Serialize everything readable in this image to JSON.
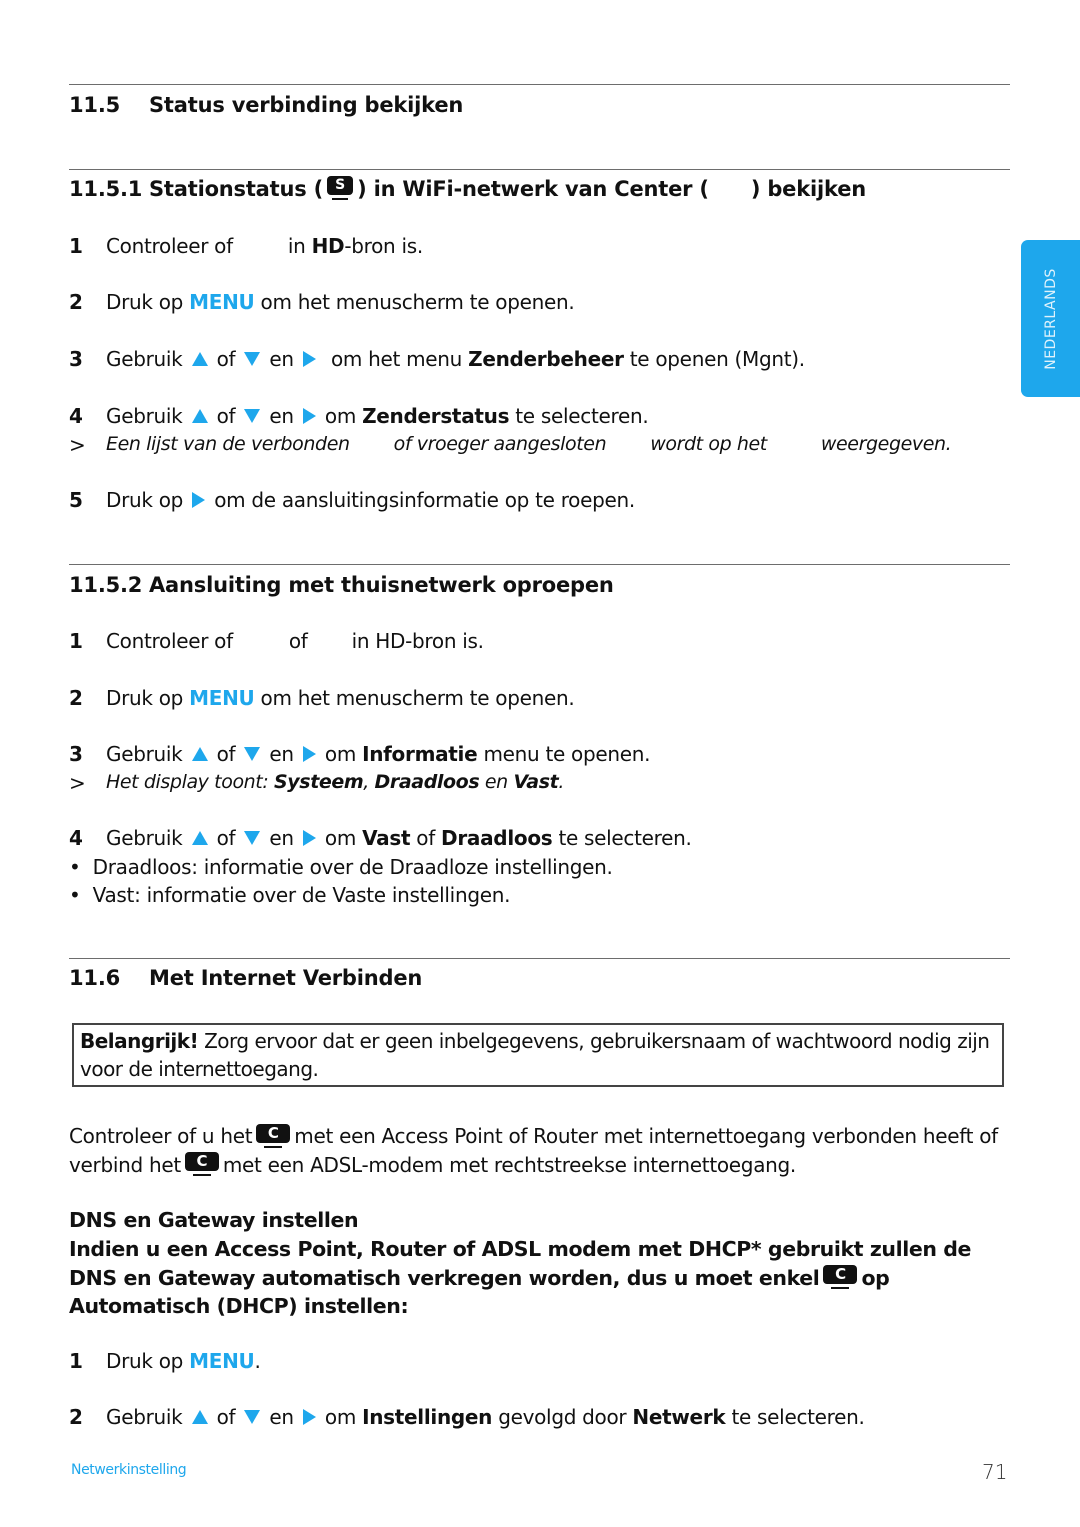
{
  "side_tab": {
    "label": "NEDERLANDS"
  },
  "section_11_5": {
    "number": "11.5",
    "title": "Status verbinding bekijken"
  },
  "section_11_5_1": {
    "number": "11.5.1",
    "title_a": "Stationstatus (",
    "icon_a": "S",
    "title_b": ") in WiFi-netwerk van Center (",
    "title_c": ") bekijken",
    "steps": [
      {
        "num": "1",
        "a": "Controleer of",
        "b": "in",
        "c": "HD",
        "d": "-bron is."
      },
      {
        "num": "2",
        "a": "Druk op",
        "accent": "MENU",
        "b": "om het menuscherm te openen."
      },
      {
        "num": "3",
        "a": "Gebruik",
        "of": "of",
        "en": "en",
        "b": "om het menu",
        "bold": "Zenderbeheer",
        "c": "te openen (Mgnt)."
      },
      {
        "num": "4",
        "a": "Gebruik",
        "of": "of",
        "en": "en",
        "b": "om",
        "bold": "Zenderstatus",
        "c": "te selecteren."
      },
      {
        "num": "5",
        "a": "Druk op",
        "b": "om de aansluitingsinformatie op te roepen."
      }
    ],
    "result": {
      "mark": ">",
      "parts": [
        "Een lijst van de verbonden",
        "of vroeger aangesloten",
        "wordt op het",
        "weergegeven."
      ]
    }
  },
  "section_11_5_2": {
    "number": "11.5.2",
    "title": "Aansluiting met thuisnetwerk oproepen",
    "steps": [
      {
        "num": "1",
        "a": "Controleer of",
        "b": "of",
        "c": "in HD-bron is."
      },
      {
        "num": "2",
        "a": "Druk op",
        "accent": "MENU",
        "b": "om het menuscherm te openen."
      },
      {
        "num": "3",
        "a": "Gebruik",
        "of": "of",
        "en": "en",
        "b": "om",
        "bold": "Informatie",
        "c": "menu te openen."
      },
      {
        "num": "4",
        "a": "Gebruik",
        "of": "of",
        "en": "en",
        "b": "om",
        "bold1": "Vast",
        "mid": "of",
        "bold2": "Draadloos",
        "c": "te selecteren."
      }
    ],
    "result": {
      "mark": ">",
      "a": "Het display toont:",
      "b1": "Systeem",
      "sep": ",",
      "b2": "Draadloos",
      "en": "en",
      "b3": "Vast",
      "end": "."
    },
    "bullets": [
      "Draadloos: informatie over de Draadloze instellingen.",
      "Vast: informatie over de Vaste instellingen."
    ]
  },
  "section_11_6": {
    "number": "11.6",
    "title": "Met Internet Verbinden",
    "notice": {
      "bold": "Belangrijk!",
      "text": "Zorg ervoor dat er geen inbelgegevens, gebruikersnaam of wachtwoord nodig zijn voor de internettoegang."
    },
    "para": {
      "a": "Controleer of u het",
      "icon": "C",
      "b": "met een Access Point of Router met internettoegang verbonden heeft of verbind het",
      "c": "met een ADSL-modem met rechtstreekse internettoegang."
    },
    "dns": {
      "title": "DNS en Gateway instellen",
      "p1": "Indien u een Access Point, Router of ADSL modem met DHCP* gebruikt zullen de DNS en Gateway automatisch verkregen worden, dus u moet enkel",
      "icon": "C",
      "p2": "op",
      "p3": "Automatisch (DHCP) instellen:"
    },
    "steps": [
      {
        "num": "1",
        "a": "Druk op",
        "accent": "MENU",
        "b": "."
      },
      {
        "num": "2",
        "a": "Gebruik",
        "of": "of",
        "en": "en",
        "b": "om",
        "bold1": "Instellingen",
        "mid": "gevolgd door",
        "bold2": "Netwerk",
        "c": "te selecteren."
      }
    ]
  },
  "footer": {
    "section": "Netwerkinstelling",
    "page": "71"
  },
  "colors": {
    "accent": "#1ea7ec",
    "rule": "#6d6d6d",
    "text": "#111111"
  }
}
